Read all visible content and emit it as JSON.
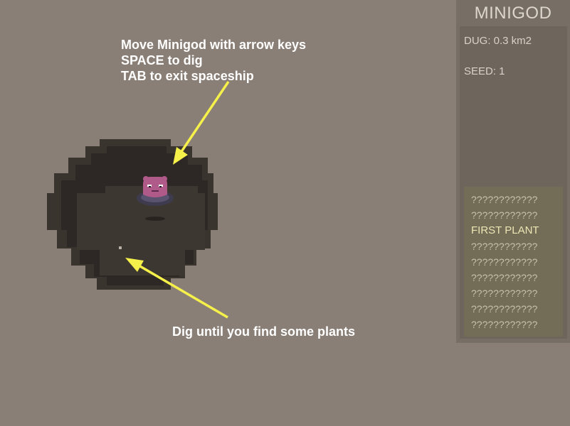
{
  "tutorial": {
    "lines": [
      "Move Minigod with arrow keys",
      "SPACE to dig",
      "TAB to exit spaceship"
    ],
    "hint": "Dig until you find some plants"
  },
  "panel": {
    "title": "MINIGOD",
    "dug": "DUG: 0.3 km2",
    "seed": "SEED: 1",
    "plants": [
      "????????????",
      "????????????",
      "FIRST PLANT",
      "????????????",
      "????????????",
      "????????????",
      "????????????",
      "????????????",
      "????????????"
    ],
    "found_index": 2
  },
  "colors": {
    "ground": "#8a7f76",
    "hole": "#2f2a26",
    "arrow": "#f5f04a",
    "creature": "#b05a8a",
    "creature_ring": "#3f3b4e"
  },
  "icons": [
    "minigod-creature-icon",
    "arrow-icon"
  ]
}
